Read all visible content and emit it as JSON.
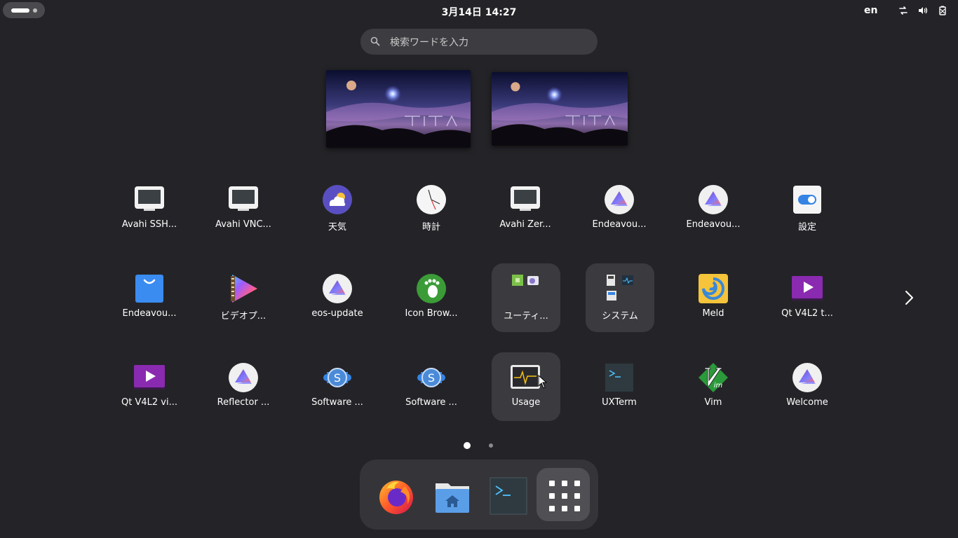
{
  "topbar": {
    "clock": "3月14日  14:27",
    "lang": "en"
  },
  "search": {
    "placeholder": "検索ワードを入力"
  },
  "apps": [
    {
      "label": "Avahi SSH...",
      "icon": "monitor-icon"
    },
    {
      "label": "Avahi VNC...",
      "icon": "monitor-icon"
    },
    {
      "label": "天気",
      "icon": "weather-icon"
    },
    {
      "label": "時計",
      "icon": "clock-icon"
    },
    {
      "label": "Avahi Zer...",
      "icon": "monitor-icon"
    },
    {
      "label": "Endeavou...",
      "icon": "endeavour-icon"
    },
    {
      "label": "Endeavou...",
      "icon": "endeavour-icon"
    },
    {
      "label": "設定",
      "icon": "settings-toggle-icon"
    },
    {
      "label": "Endeavou...",
      "icon": "shopping-bag-icon"
    },
    {
      "label": "ビデオプ...",
      "icon": "video-player-icon"
    },
    {
      "label": "eos-update",
      "icon": "endeavour-icon"
    },
    {
      "label": "Icon Brow...",
      "icon": "gnome-foot-icon"
    },
    {
      "label": "ユーティ...",
      "icon": "folder-utilities-icon"
    },
    {
      "label": "システム",
      "icon": "folder-system-icon"
    },
    {
      "label": "Meld",
      "icon": "meld-icon"
    },
    {
      "label": "Qt V4L2 t...",
      "icon": "qt-v4l2-icon"
    },
    {
      "label": "Qt V4L2 vi...",
      "icon": "qt-v4l2-icon"
    },
    {
      "label": "Reflector ...",
      "icon": "endeavour-icon"
    },
    {
      "label": "Software ...",
      "icon": "software-icon"
    },
    {
      "label": "Software ...",
      "icon": "software-icon"
    },
    {
      "label": "Usage",
      "icon": "usage-monitor-icon"
    },
    {
      "label": "UXTerm",
      "icon": "terminal-icon"
    },
    {
      "label": "Vim",
      "icon": "vim-icon"
    },
    {
      "label": "Welcome",
      "icon": "endeavour-icon"
    }
  ],
  "dock": [
    {
      "name": "firefox",
      "icon": "firefox-icon"
    },
    {
      "name": "files",
      "icon": "home-folder-icon"
    },
    {
      "name": "terminal",
      "icon": "terminal-icon"
    },
    {
      "name": "show-apps",
      "icon": "app-grid-icon"
    }
  ],
  "pager": {
    "pages": 2,
    "current": 1
  },
  "colors": {
    "background": "#242428",
    "tile_bg": "#3b3b3f",
    "accent": "#3584e4"
  }
}
